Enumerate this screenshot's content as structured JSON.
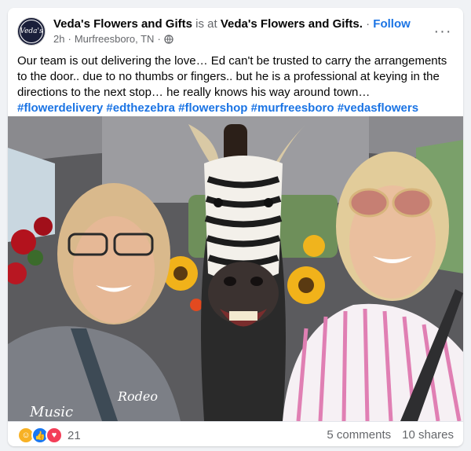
{
  "post": {
    "page_name": "Veda's Flowers and Gifts",
    "is_at": "is at",
    "location_tag": "Veda's Flowers and Gifts",
    "dot": "·",
    "follow_label": "Follow",
    "time": "2h",
    "place": "Murfreesboro, TN",
    "avatar_text": "Veda's",
    "more_label": "···",
    "text": "Our team is out delivering the love… Ed can't be trusted to carry the arrangements to the door.. due to no thumbs or fingers.. but he is a professional at keying in the directions to the next stop… he really knows his way around town…",
    "hashtags": [
      "#flowerdelivery",
      "#edthezebra",
      "#flowershop",
      "#murfreesboro",
      "#vedasflowers"
    ]
  },
  "reactions": {
    "icons": [
      "haha-icon",
      "like-icon",
      "love-icon"
    ],
    "count": "21"
  },
  "stats": {
    "comments": "5 comments",
    "shares": "10 shares"
  },
  "colors": {
    "link": "#1b74e4",
    "muted": "#65676b",
    "like": "#1877f2",
    "love": "#f33e58",
    "haha": "#f7b125"
  },
  "photo": {
    "shirt_text_1": "Music",
    "shirt_text_2": "Rodeo"
  }
}
